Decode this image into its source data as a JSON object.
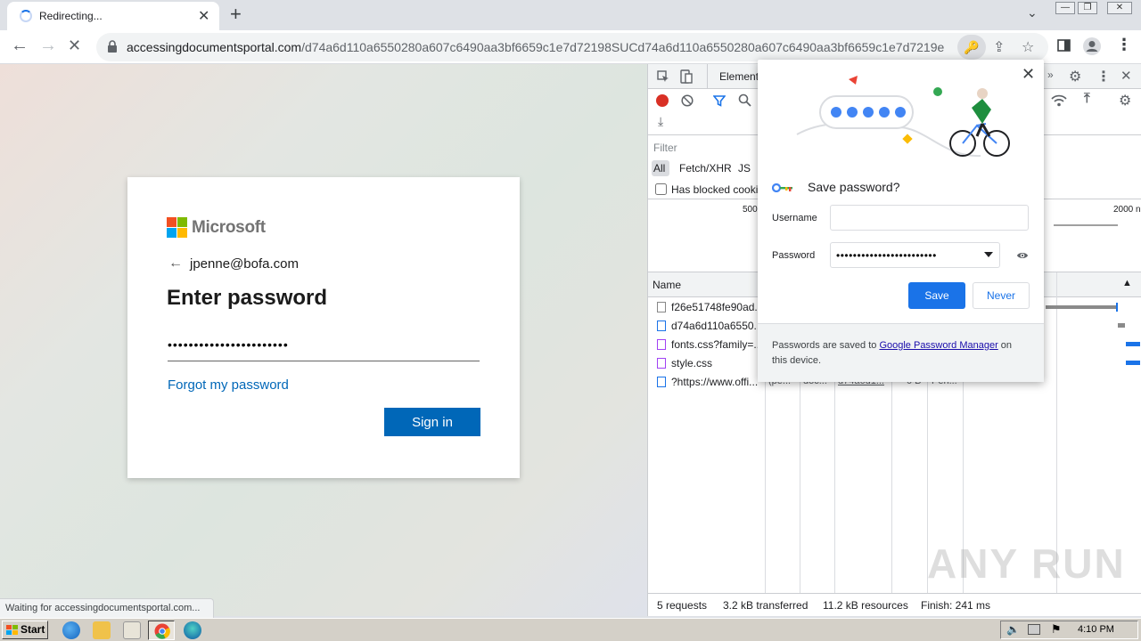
{
  "browser": {
    "tab_title": "Redirecting...",
    "url_host": "accessingdocumentsportal.com",
    "url_path": "/d74a6d110a6550280a607c6490aa3bf6659c1e7d72198SUCd74a6d110a6550280a607c6490aa3bf6659c1e7d7219e",
    "status_text": "Waiting for accessingdocumentsportal.com..."
  },
  "login": {
    "brand": "Microsoft",
    "email": "jpenne@bofa.com",
    "heading": "Enter password",
    "password_value": "•••••••••••••••••••••••",
    "forgot_link": "Forgot my password",
    "signin_label": "Sign in"
  },
  "devtools": {
    "tab_elements": "Element",
    "filter_label": "Filter",
    "filter_all": "All",
    "filter_fetch": "Fetch/XHR",
    "filter_js": "JS",
    "has_blocked": "Has blocked cooki",
    "tick_500": "500",
    "tick_2000": "2000 n",
    "col_name": "Name",
    "rows": [
      {
        "name": "f26e51748fe90ad..."
      },
      {
        "name": "d74a6d110a6550..."
      },
      {
        "name": "fonts.css?family=..."
      },
      {
        "name": "style.css"
      },
      {
        "name": "?https://www.offi..."
      }
    ],
    "row5_cells": [
      "(pe...",
      "doc...",
      "d74a6d1...",
      "0 B",
      "Pen..."
    ],
    "summary": {
      "requests": "5 requests",
      "transferred": "3.2 kB transferred",
      "resources": "11.2 kB resources",
      "finish": "Finish: 241 ms"
    }
  },
  "password_popup": {
    "title": "Save password?",
    "username_label": "Username",
    "username_value": "",
    "password_label": "Password",
    "password_value": "••••••••••••••••••••••••",
    "save_label": "Save",
    "never_label": "Never",
    "footer_prefix": "Passwords are saved to ",
    "footer_link": "Google Password Manager",
    "footer_suffix": " on this device."
  },
  "taskbar": {
    "start_label": "Start",
    "clock": "4:10 PM"
  },
  "watermark": "ANY RUN",
  "colors": {
    "accent": "#1a73e8",
    "ms_blue": "#0067b8"
  }
}
